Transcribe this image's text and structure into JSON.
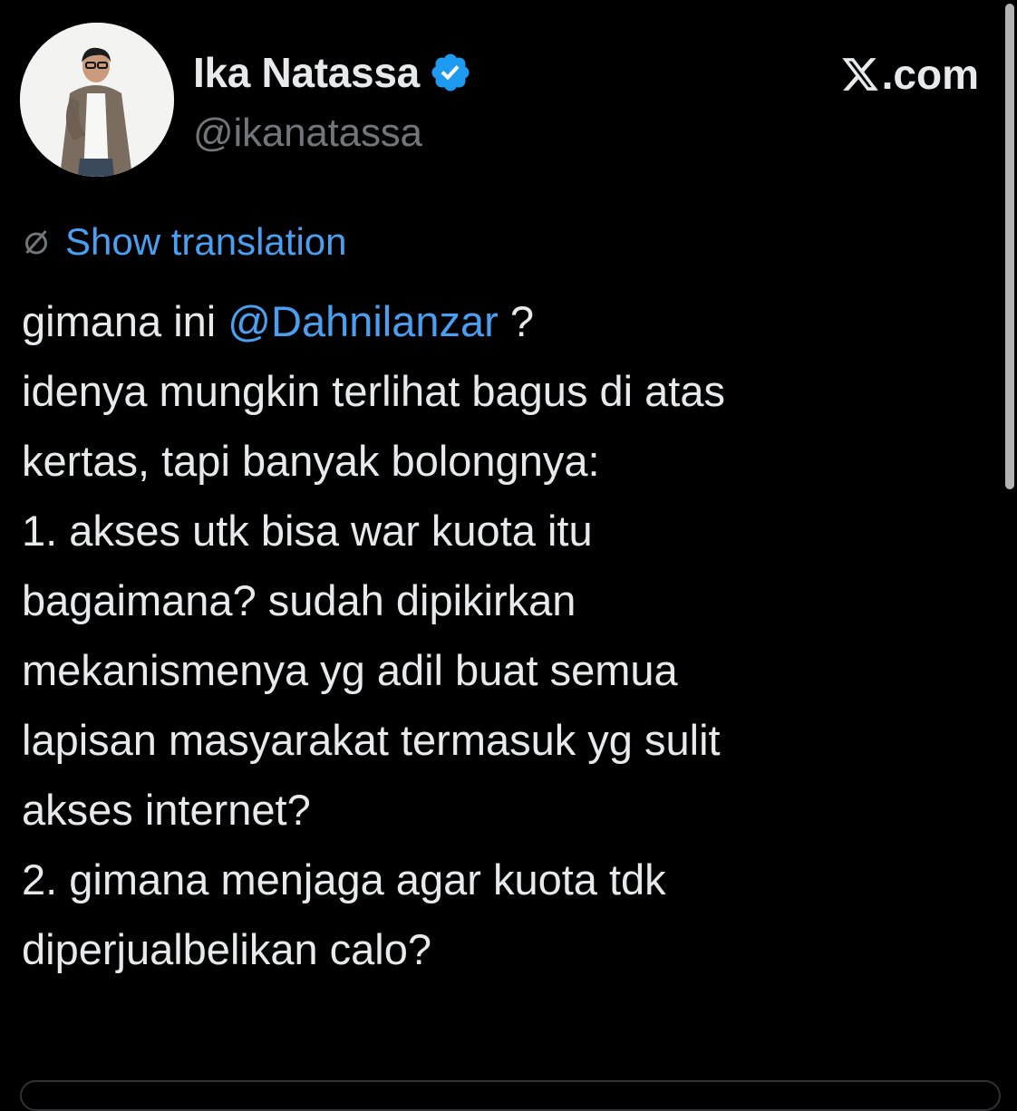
{
  "author": {
    "display_name": "Ika Natassa",
    "handle": "@ikanatassa",
    "verified_icon": "verified-badge-icon",
    "verified_color": "#1d9bf0"
  },
  "brand": {
    "logo_icon": "x-logo-icon",
    "label": ".com"
  },
  "translation": {
    "icon": "globe-icon",
    "label": "Show translation"
  },
  "tweet": {
    "line1_before": "gimana ini ",
    "mention": "@Dahnilanzar",
    "line1_after": " ?",
    "lines": [
      "idenya mungkin terlihat bagus di atas",
      "kertas, tapi banyak bolongnya:",
      "1. akses utk bisa war kuota itu",
      "bagaimana? sudah dipikirkan",
      "mekanismenya yg adil buat semua",
      "lapisan masyarakat termasuk yg sulit",
      "akses internet?",
      "2. gimana menjaga agar kuota tdk",
      "diperjualbelikan calo?"
    ]
  },
  "colors": {
    "background": "#000000",
    "text": "#e7e9ea",
    "secondary_text": "#71767b",
    "link": "#4a9ff0"
  }
}
